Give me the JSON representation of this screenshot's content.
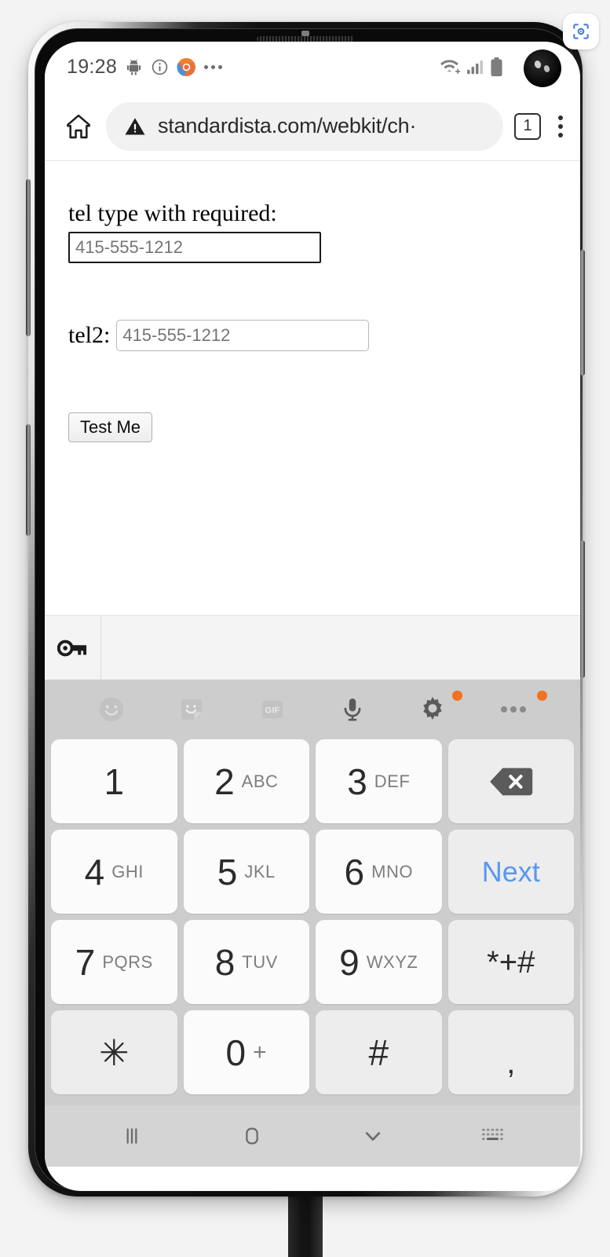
{
  "capture_badge": {
    "icon": "screenshot-capture-icon"
  },
  "status_bar": {
    "clock": "19:28",
    "icons": [
      "android-debug-icon",
      "info-circle-icon",
      "chrome-icon",
      "overflow-dots-icon"
    ],
    "right_icons": [
      "wifi-icon",
      "cellular-signal-icon",
      "battery-icon"
    ]
  },
  "browser": {
    "home_icon": "home-icon",
    "security_icon": "warning-triangle-icon",
    "url": "standardista.com/webkit/ch·",
    "tab_count": "1",
    "menu_icon": "overflow-menu-icon"
  },
  "webpage": {
    "tel1": {
      "label": "tel type with required:",
      "value": "",
      "placeholder": "415-555-1212"
    },
    "tel2": {
      "label": "tel2:",
      "value": "",
      "placeholder": "415-555-1212"
    },
    "submit_label": "Test Me"
  },
  "autofill": {
    "key_icon": "key-icon",
    "suggestion": ""
  },
  "keyboard": {
    "toolbar": [
      {
        "name": "emoji-icon",
        "badge": false
      },
      {
        "name": "sticker-icon",
        "badge": false
      },
      {
        "name": "gif-icon",
        "badge": false,
        "label": "GIF"
      },
      {
        "name": "microphone-icon",
        "badge": false
      },
      {
        "name": "gear-icon",
        "badge": true
      },
      {
        "name": "overflow-dots-icon",
        "badge": true
      }
    ],
    "rows": [
      [
        {
          "main": "1",
          "sub": "",
          "type": "num"
        },
        {
          "main": "2",
          "sub": "ABC",
          "type": "num"
        },
        {
          "main": "3",
          "sub": "DEF",
          "type": "num"
        },
        {
          "main": "",
          "sub": "",
          "type": "fn",
          "icon": "backspace-icon"
        }
      ],
      [
        {
          "main": "4",
          "sub": "GHI",
          "type": "num"
        },
        {
          "main": "5",
          "sub": "JKL",
          "type": "num"
        },
        {
          "main": "6",
          "sub": "MNO",
          "type": "num"
        },
        {
          "main": "Next",
          "sub": "",
          "type": "fn",
          "style": "next"
        }
      ],
      [
        {
          "main": "7",
          "sub": "PQRS",
          "type": "num"
        },
        {
          "main": "8",
          "sub": "TUV",
          "type": "num"
        },
        {
          "main": "9",
          "sub": "WXYZ",
          "type": "num"
        },
        {
          "main": "*+#",
          "sub": "",
          "type": "fn",
          "style": "sym"
        }
      ],
      [
        {
          "main": "✳",
          "sub": "",
          "type": "fn",
          "style": "sym"
        },
        {
          "main": "0",
          "sub": "+",
          "type": "num"
        },
        {
          "main": "#",
          "sub": "",
          "type": "fn",
          "style": "sym"
        },
        {
          "main": ",",
          "sub": "",
          "type": "fn",
          "style": "comma"
        }
      ]
    ]
  },
  "nav_bar": {
    "items": [
      "recents-icon",
      "home-icon",
      "chevron-down-dismiss-icon",
      "keyboard-switch-icon"
    ]
  },
  "colors": {
    "accent_blue": "#5998f0",
    "badge_orange": "#f2721f",
    "keyboard_bg": "#cdcdcd",
    "navbar_bg": "#d4d4d4"
  }
}
